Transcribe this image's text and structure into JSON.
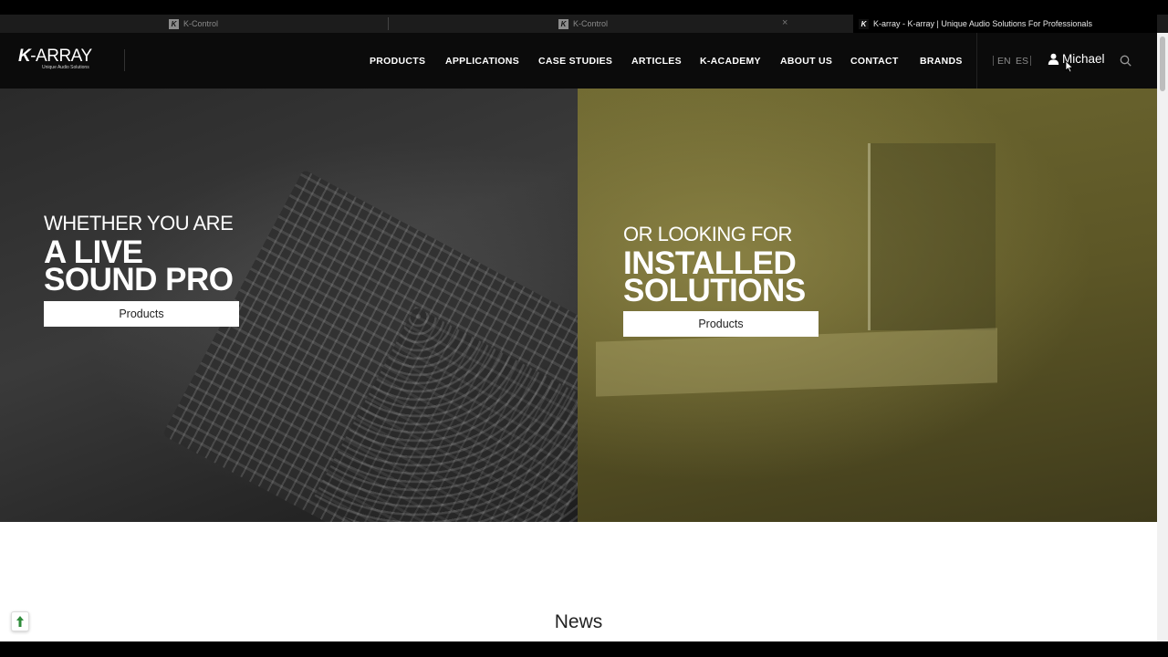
{
  "browser": {
    "tabs": [
      {
        "title": "K-Control",
        "active": false
      },
      {
        "title": "K-Control",
        "active": false
      },
      {
        "title": "K-array - K-array | Unique Audio Solutions For Professionals",
        "active": true
      }
    ],
    "close_glyph": "×"
  },
  "header": {
    "logo": {
      "brand_k": "K",
      "brand_rest": "-ARRAY",
      "tagline": "Unique Audio Solutions"
    },
    "nav": [
      "PRODUCTS",
      "APPLICATIONS",
      "CASE STUDIES",
      "ARTICLES",
      "K-ACADEMY",
      "ABOUT US",
      "CONTACT",
      "BRANDS"
    ],
    "languages": [
      "EN",
      "ES"
    ],
    "user_name": "Michael",
    "icons": [
      "user-icon",
      "search-icon"
    ]
  },
  "hero": {
    "left": {
      "small": "WHETHER YOU ARE",
      "big_line1": "A LIVE",
      "big_line2": "SOUND PRO",
      "button": "Products"
    },
    "right": {
      "small": "OR LOOKING FOR",
      "big_line1": "INSTALLED",
      "big_line2": "SOLUTIONS",
      "button": "Products"
    },
    "colors": {
      "right_tint": "#5c5626",
      "left_tone": "#2a2a2a"
    }
  },
  "content": {
    "section_title": "News",
    "scroll_top_icon": "arrow-up-icon"
  }
}
